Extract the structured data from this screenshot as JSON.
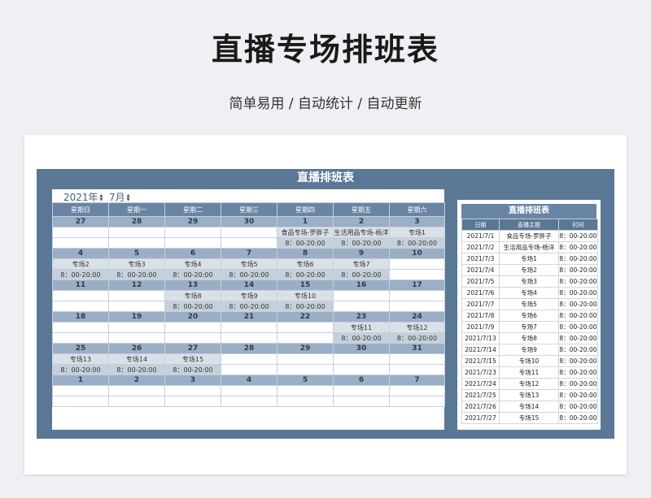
{
  "header": {
    "title": "直播专场排班表",
    "subtitle": "简单易用  /  自动统计  /  自动更新"
  },
  "panel_title": "直播排班表",
  "selector": {
    "year": "2021年",
    "month": "7月"
  },
  "weekdays": [
    "星期日",
    "星期一",
    "星期二",
    "星期三",
    "星期四",
    "星期五",
    "星期六"
  ],
  "weeks": [
    {
      "dates": [
        "27",
        "28",
        "29",
        "30",
        "1",
        "2",
        "3"
      ],
      "events": [
        "",
        "",
        "",
        "",
        "食品专场-罗胖子",
        "生活用品专场-杨洋",
        "专场1"
      ],
      "times": [
        "",
        "",
        "",
        "",
        "8：00-20:00",
        "8：00-20:00",
        "8：00-20:00"
      ]
    },
    {
      "dates": [
        "4",
        "5",
        "6",
        "7",
        "8",
        "9",
        "10"
      ],
      "events": [
        "专场2",
        "专场3",
        "专场4",
        "专场5",
        "专场6",
        "专场7",
        ""
      ],
      "times": [
        "8：00-20:00",
        "8：00-20:00",
        "8：00-20:00",
        "8：00-20:00",
        "8：00-20:00",
        "8：00-20:00",
        ""
      ]
    },
    {
      "dates": [
        "11",
        "12",
        "13",
        "14",
        "15",
        "16",
        "17"
      ],
      "events": [
        "",
        "",
        "专场8",
        "专场9",
        "专场10",
        "",
        ""
      ],
      "times": [
        "",
        "",
        "8：00-20:00",
        "8：00-20:00",
        "8：00-20:00",
        "",
        ""
      ]
    },
    {
      "dates": [
        "18",
        "19",
        "20",
        "21",
        "22",
        "23",
        "24"
      ],
      "events": [
        "",
        "",
        "",
        "",
        "",
        "专场11",
        "专场12"
      ],
      "times": [
        "",
        "",
        "",
        "",
        "",
        "8：00-20:00",
        "8：00-20:00"
      ]
    },
    {
      "dates": [
        "25",
        "26",
        "27",
        "28",
        "29",
        "30",
        "31"
      ],
      "events": [
        "专场13",
        "专场14",
        "专场15",
        "",
        "",
        "",
        ""
      ],
      "times": [
        "8：00-20:00",
        "8：00-20:00",
        "8：00-20:00",
        "",
        "",
        "",
        ""
      ]
    },
    {
      "dates": [
        "1",
        "2",
        "3",
        "4",
        "5",
        "6",
        "7"
      ],
      "events": [
        "",
        "",
        "",
        "",
        "",
        "",
        ""
      ],
      "times": [
        "",
        "",
        "",
        "",
        "",
        "",
        ""
      ]
    }
  ],
  "list": {
    "title": "直播排班表",
    "columns": [
      "日期",
      "直播主题",
      "时间"
    ],
    "rows": [
      [
        "2021/7/1",
        "食品专场-罗胖子",
        "8：00-20:00"
      ],
      [
        "2021/7/2",
        "生活用品专场-杨洋",
        "8：00-20:00"
      ],
      [
        "2021/7/3",
        "专场1",
        "8：00-20:00"
      ],
      [
        "2021/7/4",
        "专场2",
        "8：00-20:00"
      ],
      [
        "2021/7/5",
        "专场3",
        "8：00-20:00"
      ],
      [
        "2021/7/6",
        "专场4",
        "8：00-20:00"
      ],
      [
        "2021/7/7",
        "专场5",
        "8：00-20:00"
      ],
      [
        "2021/7/8",
        "专场6",
        "8：00-20:00"
      ],
      [
        "2021/7/9",
        "专场7",
        "8：00-20:00"
      ],
      [
        "2021/7/13",
        "专场8",
        "8：00-20:00"
      ],
      [
        "2021/7/14",
        "专场9",
        "8：00-20:00"
      ],
      [
        "2021/7/15",
        "专场10",
        "8：00-20:00"
      ],
      [
        "2021/7/23",
        "专场11",
        "8：00-20:00"
      ],
      [
        "2021/7/24",
        "专场12",
        "8：00-20:00"
      ],
      [
        "2021/7/25",
        "专场13",
        "8：00-20:00"
      ],
      [
        "2021/7/26",
        "专场14",
        "8：00-20:00"
      ],
      [
        "2021/7/27",
        "专场15",
        "8：00-20:00"
      ]
    ]
  }
}
